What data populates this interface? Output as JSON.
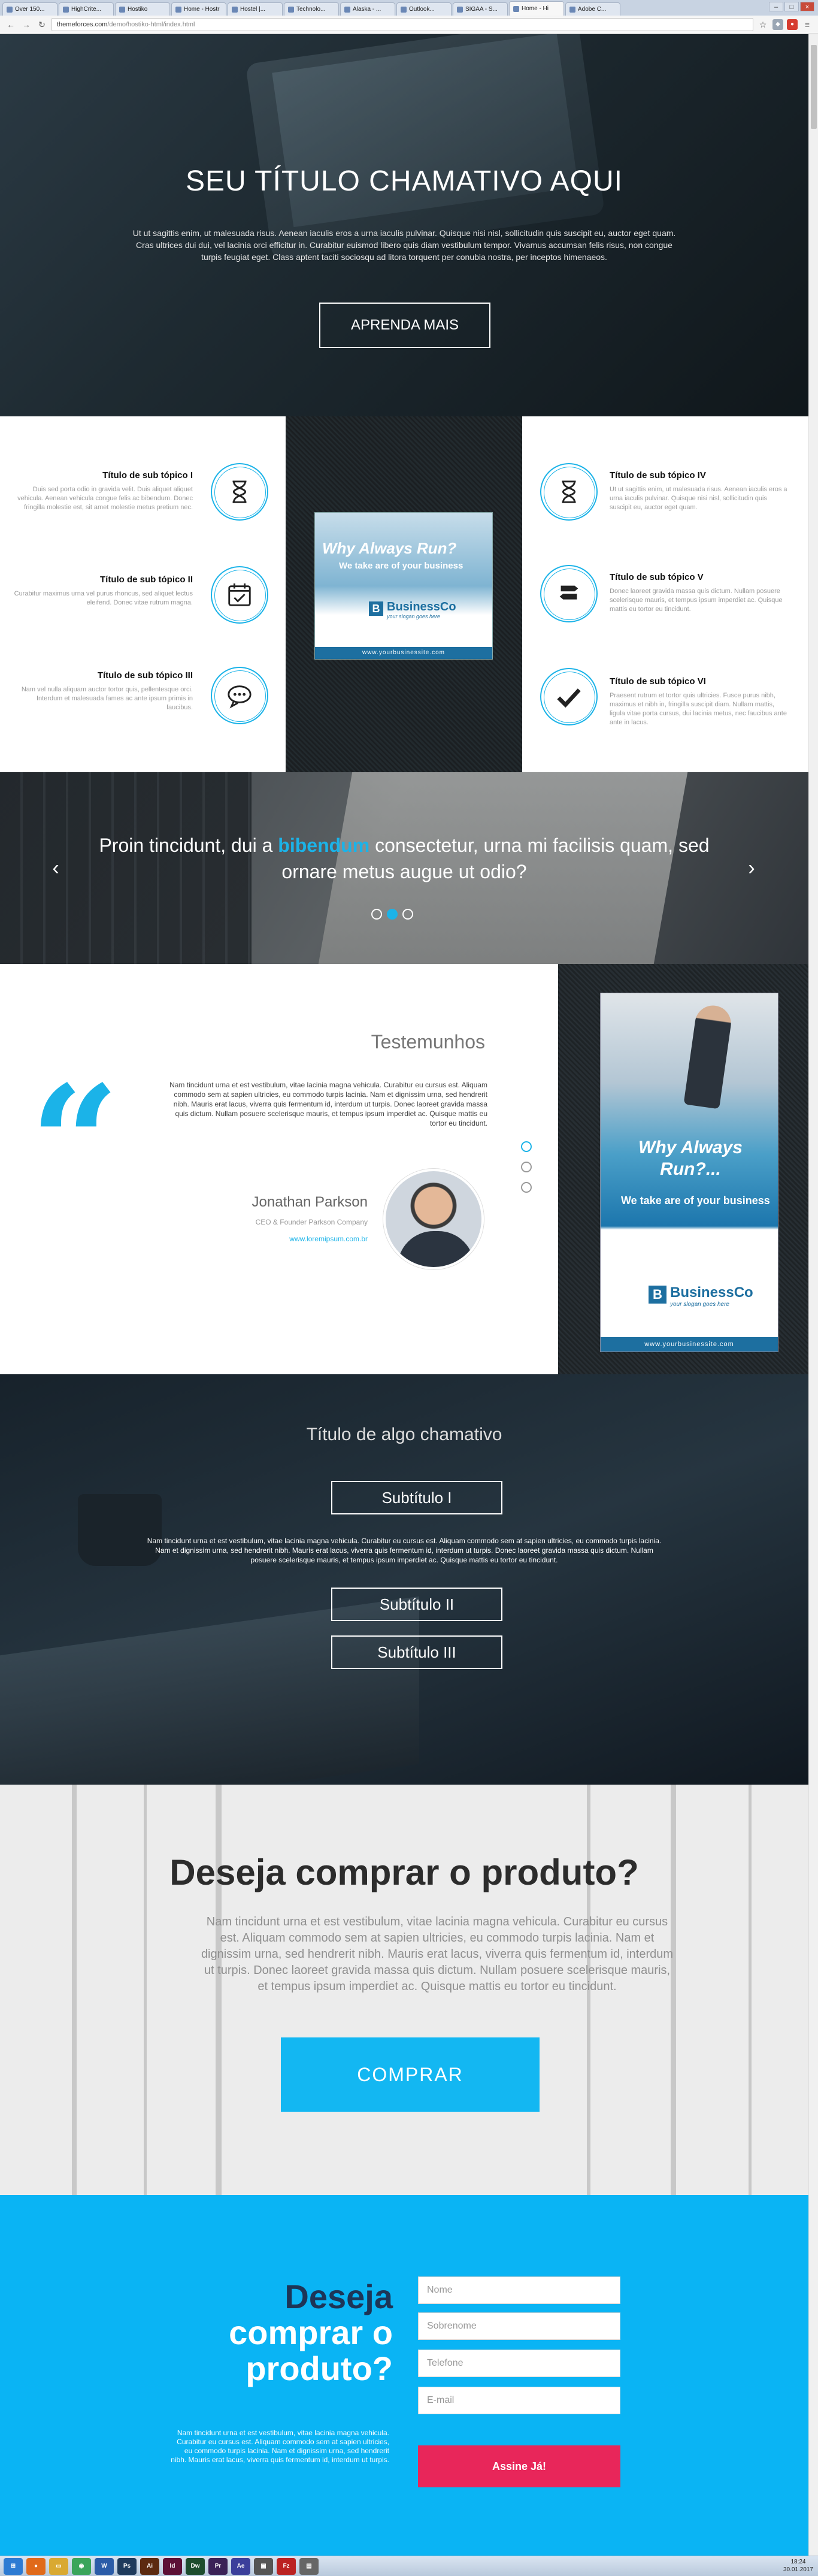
{
  "browser": {
    "tabs": [
      "Over 150...",
      "HighCrite...",
      "Hostiko",
      "Home - Hostr",
      "Hostel |...",
      "Technolo...",
      "Alaska - ...",
      "Outlook...",
      "SIGAA - S...",
      "Home - Hi",
      "Adobe C..."
    ],
    "url_host": "themeforces.com",
    "url_path": "/demo/hostiko-html/index.html"
  },
  "hero": {
    "title": "SEU TÍTULO CHAMATIVO AQUI",
    "text": "Ut ut sagittis enim, ut malesuada risus. Aenean iaculis eros a urna iaculis pulvinar. Quisque nisi nisl, sollicitudin quis suscipit eu, auctor eget quam. Cras ultrices dui dui, vel lacinia orci efficitur in. Curabitur euismod libero quis diam vestibulum tempor. Vivamus accumsan felis risus, non congue turpis feugiat eget. Class aptent taciti sociosqu ad litora torquent per conubia nostra, per inceptos himenaeos.",
    "button": "APRENDA MAIS"
  },
  "features": {
    "left": [
      {
        "title": "Título de sub tópico I",
        "text": "Duis sed porta odio in gravida velit. Duis aliquet aliquet vehicula. Aenean vehicula congue felis ac bibendum. Donec fringilla molestie est, sit amet molestie metus pretium nec.",
        "icon": "hourglass-icon"
      },
      {
        "title": "Título de sub tópico II",
        "text": "Curabitur maximus urna vel purus rhoncus, sed aliquet lectus eleifend. Donec vitae rutrum magna.",
        "icon": "calendar-check-icon"
      },
      {
        "title": "Título de sub tópico III",
        "text": "Nam vel nulla aliquam auctor tortor quis, pellentesque orci. Interdum et malesuada fames ac ante ipsum primis in faucibus.",
        "icon": "chat-icon"
      }
    ],
    "right": [
      {
        "title": "Título de sub tópico IV",
        "text": "Ut ut sagittis enim, ut malesuada risus. Aenean iaculis eros a urna iaculis pulvinar. Quisque nisi nisl, sollicitudin quis suscipit eu, auctor eget quam.",
        "icon": "hourglass-icon"
      },
      {
        "title": "Título de sub tópico V",
        "text": "Donec laoreet gravida massa quis dictum. Nullam posuere scelerisque mauris, et tempus ipsum imperdiet ac. Quisque mattis eu tortor eu tincidunt.",
        "icon": "signpost-icon"
      },
      {
        "title": "Título de sub tópico VI",
        "text": "Praesent rutrum et tortor quis ultricies. Fusce purus nibh, maximus et nibh in, fringilla suscipit diam. Nullam mattis, ligula vitae porta cursus, dui lacinia metus, nec faucibus ante ante in lacus.",
        "icon": "checkmark-icon"
      }
    ],
    "ad": {
      "headline": "Why Always Run?",
      "sub": "We take are of your business",
      "brand": "BusinessCo",
      "slogan": "your slogan goes here",
      "site": "www.yourbusinessite.com"
    }
  },
  "slider": {
    "quote_pre": "Proin tincidunt, dui a ",
    "quote_highlight": "bibendum",
    "quote_post": " consectetur, urna mi facilisis quam, sed ornare metus augue ut odio?",
    "prev": "‹",
    "next": "›"
  },
  "testimonials": {
    "title": "Testemunhos",
    "text": "Nam tincidunt urna et est vestibulum, vitae lacinia magna vehicula. Curabitur eu cursus est. Aliquam commodo sem at sapien ultricies, eu commodo turpis lacinia. Nam et dignissim urna, sed hendrerit nibh. Mauris erat lacus, viverra quis fermentum id, interdum ut turpis. Donec laoreet gravida massa quis dictum. Nullam posuere scelerisque mauris, et tempus ipsum imperdiet ac. Quisque mattis eu tortor eu tincidunt.",
    "name": "Jonathan Parkson",
    "role": "CEO & Founder Parkson Company",
    "site": "www.loremipsum.com.br",
    "ad": {
      "headline": "Why Always Run?...",
      "sub": "We take are of your business",
      "brand": "BusinessCo",
      "slogan": "your slogan goes here",
      "site": "www.yourbusinessite.com"
    }
  },
  "desk": {
    "title": "Título de algo chamativo",
    "button1": "Subtítulo I",
    "text": "Nam tincidunt urna et est vestibulum, vitae lacinia magna vehicula. Curabitur eu cursus est. Aliquam commodo sem at sapien ultricies, eu commodo turpis lacinia. Nam et dignissim urna, sed hendrerit nibh. Mauris erat lacus, viverra quis fermentum id, interdum ut turpis. Donec laoreet gravida massa quis dictum. Nullam posuere scelerisque mauris, et tempus ipsum imperdiet ac. Quisque mattis eu tortor eu tincidunt.",
    "button2": "Subtítulo II",
    "button3": "Subtítulo III"
  },
  "buy": {
    "title": "Deseja comprar o produto?",
    "text": "Nam tincidunt urna et est vestibulum, vitae lacinia magna vehicula. Curabitur eu cursus est. Aliquam commodo sem at sapien ultricies, eu commodo turpis lacinia. Nam et dignissim urna, sed hendrerit nibh. Mauris erat lacus, viverra quis fermentum id, interdum ut turpis. Donec laoreet gravida massa quis dictum. Nullam posuere scelerisque mauris, et tempus ipsum imperdiet ac. Quisque mattis eu tortor eu tincidunt.",
    "button": "COMPRAR"
  },
  "form": {
    "title_line1": "Deseja",
    "title_line2": "comprar o",
    "title_line3": "produto?",
    "text": "Nam tincidunt urna et est vestibulum, vitae lacinia magna vehicula. Curabitur eu cursus est. Aliquam commodo sem at sapien ultricies, eu commodo turpis lacinia. Nam et dignissim urna, sed hendrerit nibh. Mauris erat lacus, viverra quis fermentum id, interdum ut turpis.",
    "name_placeholder": "Nome",
    "surname_placeholder": "Sobrenome",
    "phone_placeholder": "Telefone",
    "email_placeholder": "E-mail",
    "submit": "Assine Já!"
  },
  "taskbar": {
    "time": "18:24",
    "date": "30.01.2017"
  },
  "colors": {
    "accent": "#1bb3e8",
    "cta": "#13b7f2",
    "submit": "#e8265a",
    "form_bg": "#0ab4f4",
    "form_title": "#1d3557"
  }
}
